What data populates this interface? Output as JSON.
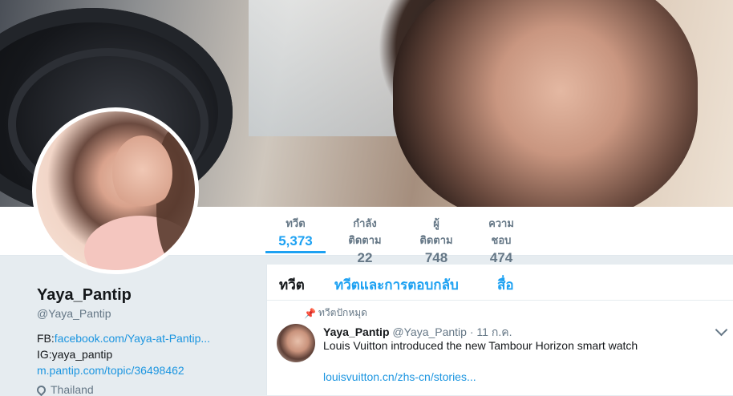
{
  "stats": [
    {
      "label": "ทวีต",
      "value": "5,373"
    },
    {
      "label": "กำลังติดตาม",
      "value": "22"
    },
    {
      "label": "ผู้ติดตาม",
      "value": "748"
    },
    {
      "label": "ความชอบ",
      "value": "474"
    }
  ],
  "profile": {
    "name": "Yaya_Pantip",
    "handle": "@Yaya_Pantip",
    "bio_line1_prefix": "FB:",
    "bio_line1_link": "facebook.com/Yaya-at-Pantip...",
    "bio_line2": "IG:yaya_pantip",
    "bio_line3_link": "m.pantip.com/topic/36498462",
    "location": "Thailand"
  },
  "timeline": {
    "tabs": [
      "ทวีต",
      "ทวีตและการตอบกลับ",
      "สื่อ"
    ],
    "pinned_label": "ทวีตปักหมุด",
    "tweet": {
      "name": "Yaya_Pantip",
      "handle": "@Yaya_Pantip",
      "separator": "·",
      "date": "11 ก.ค.",
      "text": "Louis Vuitton introduced the new Tambour Horizon smart watch",
      "link": "louisvuitton.cn/zhs-cn/stories..."
    }
  },
  "colors": {
    "accent": "#1da1f2",
    "link": "#1b95e0",
    "muted": "#657786",
    "background": "#e6ecf0"
  }
}
